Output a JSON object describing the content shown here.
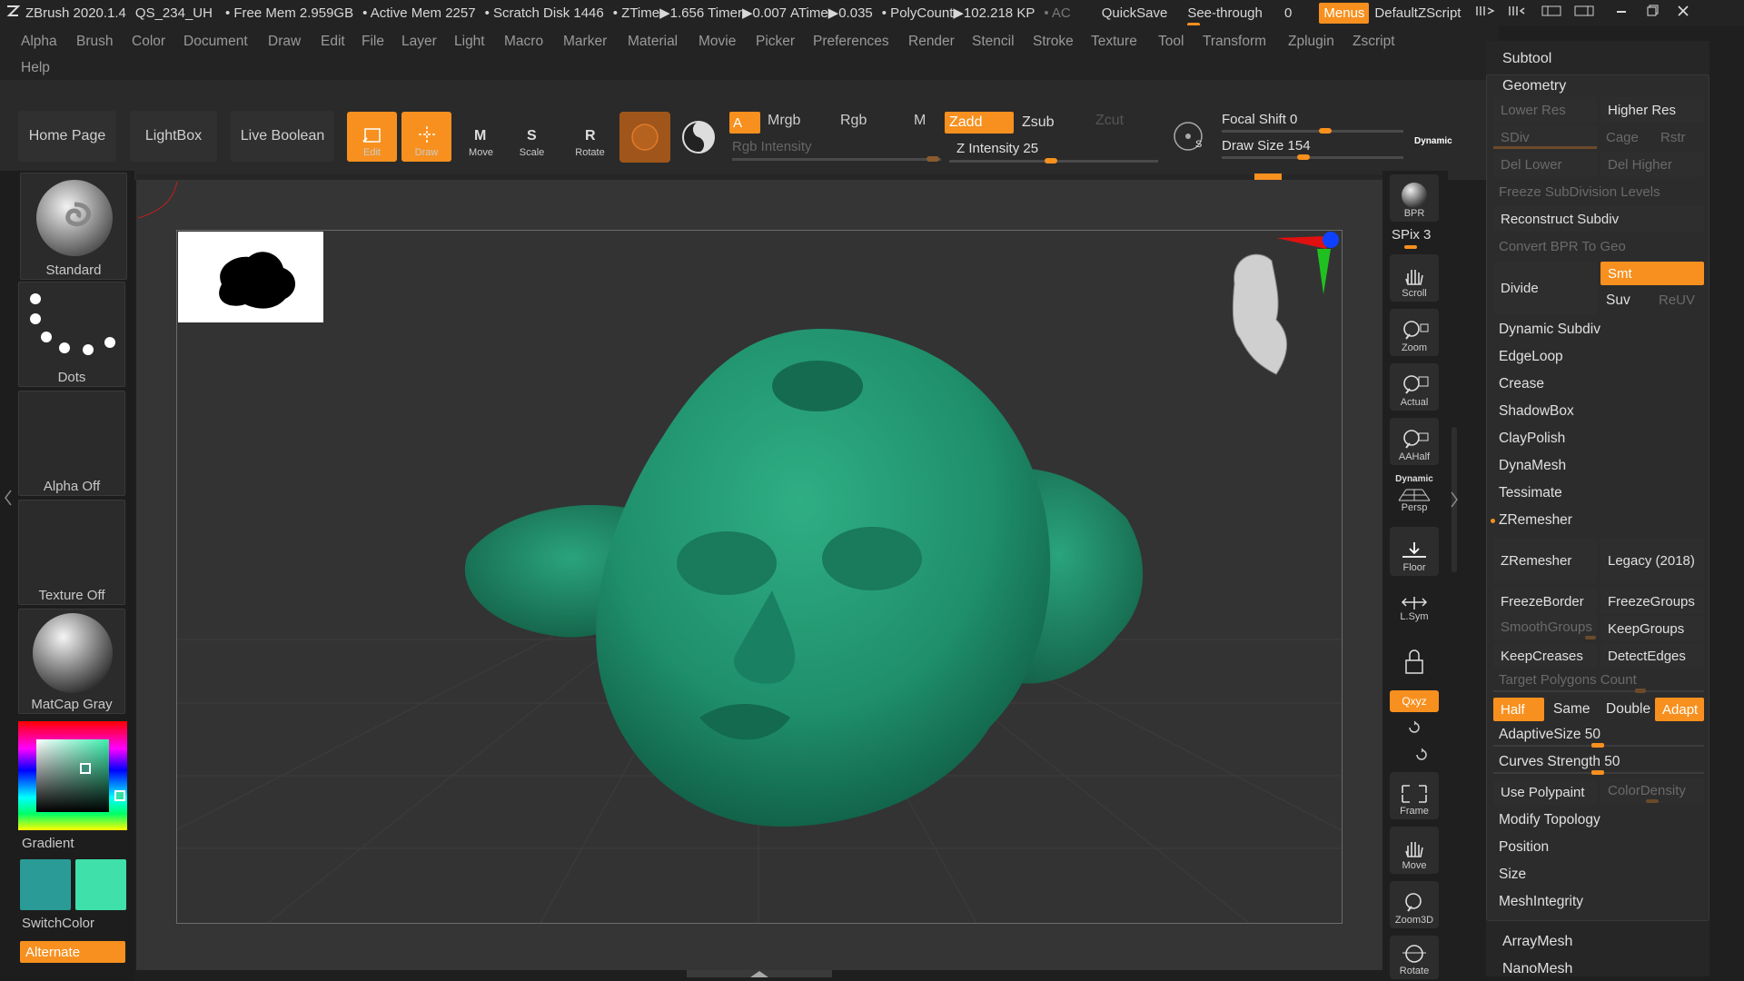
{
  "titlebar": {
    "app": "ZBrush 2020.1.4",
    "doc": "QS_234_UH",
    "free_mem": "• Free Mem 2.959GB",
    "active_mem": "• Active Mem 2257",
    "scratch": "• Scratch Disk 1446",
    "ztime": "• ZTime▶1.656",
    "timer": "Timer▶0.007",
    "atime": "ATime▶0.035",
    "polycount": "• PolyCount▶102.218 KP",
    "ac": "• AC",
    "quicksave": "QuickSave",
    "seethrough": "See-through",
    "seethrough_val": "0",
    "menus": "Menus",
    "default_zscript": "DefaultZScript"
  },
  "menus": [
    "Alpha",
    "Brush",
    "Color",
    "Document",
    "Draw",
    "Edit",
    "File",
    "Layer",
    "Light",
    "Macro",
    "Marker",
    "Material",
    "Movie",
    "Picker",
    "Preferences",
    "Render",
    "Stencil",
    "Stroke",
    "Texture",
    "Tool",
    "Transform",
    "Zplugin",
    "Zscript",
    "Help"
  ],
  "shelf": {
    "home_page": "Home Page",
    "lightbox": "LightBox",
    "live_boolean": "Live Boolean",
    "edit": "Edit",
    "draw": "Draw",
    "move": "Move",
    "scale": "Scale",
    "rotate": "Rotate",
    "a": "A",
    "mrgb": "Mrgb",
    "rgb": "Rgb",
    "m": "M",
    "rgb_intensity": "Rgb Intensity",
    "zadd": "Zadd",
    "zsub": "Zsub",
    "zcut": "Zcut",
    "z_intensity": "Z Intensity 25",
    "focal_shift": "Focal Shift 0",
    "draw_size": "Draw Size 154",
    "dynamic": "Dynamic"
  },
  "left": {
    "brush": "Standard",
    "stroke": "Dots",
    "alpha": "Alpha Off",
    "texture": "Texture Off",
    "material": "MatCap Gray",
    "gradient": "Gradient",
    "switchcolor": "SwitchColor",
    "alternate": "Alternate",
    "primary_color": "#2a9b96",
    "secondary_color": "#3fe0aa"
  },
  "rightstrip": {
    "bpr": "BPR",
    "spix": "SPix 3",
    "scroll": "Scroll",
    "zoom": "Zoom",
    "actual": "Actual",
    "aahalf": "AAHalf",
    "dynamic": "Dynamic",
    "persp": "Persp",
    "floor": "Floor",
    "lsym": "L.Sym",
    "xyz": "Qxyz",
    "frame": "Frame",
    "move": "Move",
    "zoom3d": "Zoom3D",
    "rotate": "Rotate"
  },
  "panel": {
    "subtool": "Subtool",
    "geometry": "Geometry",
    "lower_res": "Lower Res",
    "higher_res": "Higher Res",
    "sdiv": "SDiv",
    "cage": "Cage",
    "rstr": "Rstr",
    "del_lower": "Del Lower",
    "del_higher": "Del Higher",
    "freeze_subdiv": "Freeze SubDivision Levels",
    "reconstruct_subdiv": "Reconstruct Subdiv",
    "convert_bpr": "Convert BPR To Geo",
    "divide": "Divide",
    "smt": "Smt",
    "suv": "Suv",
    "reuv": "ReUV",
    "dynamic_subdiv": "Dynamic Subdiv",
    "edgeloop": "EdgeLoop",
    "crease": "Crease",
    "shadowbox": "ShadowBox",
    "claypolish": "ClayPolish",
    "dynamesh": "DynaMesh",
    "tessimate": "Tessimate",
    "zremesher_header": "ZRemesher",
    "zremesher_btn": "ZRemesher",
    "legacy": "Legacy (2018)",
    "freezeborder": "FreezeBorder",
    "freezegroups": "FreezeGroups",
    "smoothgroups": "SmoothGroups",
    "keepgroups": "KeepGroups",
    "keepcreases": "KeepCreases",
    "detectedges": "DetectEdges",
    "target_poly": "Target Polygons Count",
    "half": "Half",
    "same": "Same",
    "double": "Double",
    "adapt": "Adapt",
    "adaptive_size": "AdaptiveSize 50",
    "curves_strength": "Curves Strength 50",
    "use_polypaint": "Use Polypaint",
    "color_density": "ColorDensity",
    "modify_topology": "Modify Topology",
    "position": "Position",
    "size": "Size",
    "meshintegrity": "MeshIntegrity",
    "arraymesh": "ArrayMesh",
    "nanomesh": "NanoMesh"
  },
  "colors": {
    "accent": "#f7901e",
    "model": "#1f8f6b"
  }
}
